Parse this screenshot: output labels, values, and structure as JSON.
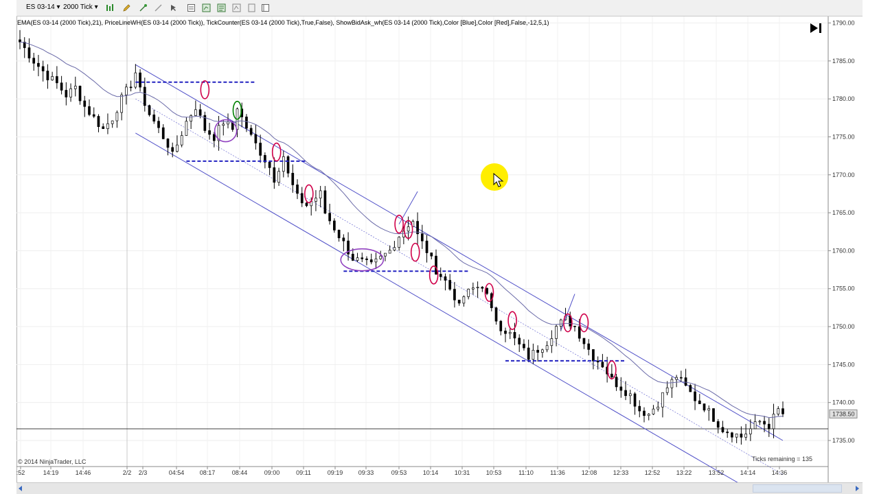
{
  "toolbar": {
    "instrument": "ES 03-14",
    "interval": "2000 Tick"
  },
  "indicator_label": "EMA(ES 03-14 (2000 Tick),21), PriceLineWH(ES 03-14 (2000 Tick)), TickCounter(ES 03-14 (2000 Tick),True,False), ShowBidAsk_wh(ES 03-14 (2000 Tick),Color [Blue],Color [Red],False,-12,5,1)",
  "copyright": "© 2014 NinjaTrader, LLC",
  "ticks_remaining": "Ticks remaining = 135",
  "colors": {
    "candle": "#000000",
    "ema": "#6a6aa8",
    "channel": "#5050c8",
    "dashed_level": "#2020c0",
    "red_marker": "#d0004a",
    "purple_marker": "#9040c0",
    "green_marker": "#008000",
    "cursor_highlight": "#ffee00"
  },
  "chart_data": {
    "type": "candlestick",
    "instrument": "ES 03-14",
    "interval": "2000 Tick",
    "y_ticks": [
      1790,
      1785,
      1780,
      1775,
      1770,
      1765,
      1760,
      1755,
      1750,
      1745,
      1740,
      1735
    ],
    "y_tick_labels": [
      "1790.00",
      "1785.00",
      "1780.00",
      "1775.00",
      "1770.00",
      "1765.00",
      "1760.00",
      "1755.00",
      "1750.00",
      "1745.00",
      "1740.00",
      "1735.00"
    ],
    "ylim": [
      1732.5,
      1790.3
    ],
    "current_price": "1738.50",
    "x_tick_labels": [
      ":52",
      "14:19",
      "14:46",
      "2/2",
      "2/3",
      "04:54",
      "08:17",
      "08:44",
      "09:00",
      "09:11",
      "09:19",
      "09:33",
      "09:53",
      "10:14",
      "10:31",
      "10:53",
      "11:10",
      "11:36",
      "12:08",
      "12:33",
      "12:52",
      "13:22",
      "13:52",
      "14:14",
      "14:36"
    ],
    "price_path": [
      [
        0,
        1787.5
      ],
      [
        3,
        1785
      ],
      [
        6,
        1783
      ],
      [
        8,
        1782
      ],
      [
        10,
        1780.5
      ],
      [
        12,
        1781.5
      ],
      [
        14,
        1779
      ],
      [
        16,
        1777.5
      ],
      [
        18,
        1776
      ],
      [
        20,
        1777.5
      ],
      [
        22,
        1780
      ],
      [
        24,
        1782
      ],
      [
        25,
        1783.5
      ],
      [
        26,
        1781
      ],
      [
        28,
        1778
      ],
      [
        30,
        1776
      ],
      [
        32,
        1774
      ],
      [
        33,
        1772.5
      ],
      [
        34,
        1774
      ],
      [
        36,
        1777
      ],
      [
        38,
        1779
      ],
      [
        40,
        1776
      ],
      [
        42,
        1775
      ],
      [
        44,
        1777
      ],
      [
        46,
        1776
      ],
      [
        47,
        1779
      ],
      [
        48,
        1777.5
      ],
      [
        50,
        1775
      ],
      [
        52,
        1773
      ],
      [
        54,
        1771
      ],
      [
        55,
        1769.5
      ],
      [
        56,
        1771
      ],
      [
        57,
        1772.5
      ],
      [
        58,
        1770
      ],
      [
        60,
        1767
      ],
      [
        62,
        1766
      ],
      [
        64,
        1767
      ],
      [
        65,
        1767.5
      ],
      [
        66,
        1765
      ],
      [
        68,
        1763
      ],
      [
        70,
        1761
      ],
      [
        72,
        1759
      ],
      [
        74,
        1758.5
      ],
      [
        76,
        1758
      ],
      [
        78,
        1759
      ],
      [
        80,
        1760
      ],
      [
        82,
        1762
      ],
      [
        84,
        1763.5
      ],
      [
        85,
        1764
      ],
      [
        86,
        1762
      ],
      [
        88,
        1760
      ],
      [
        90,
        1757.5
      ],
      [
        92,
        1756
      ],
      [
        94,
        1754
      ],
      [
        95,
        1752.5
      ],
      [
        96,
        1754
      ],
      [
        98,
        1755
      ],
      [
        100,
        1755.5
      ],
      [
        101,
        1754
      ],
      [
        102,
        1752
      ],
      [
        104,
        1750
      ],
      [
        106,
        1749
      ],
      [
        108,
        1747.5
      ],
      [
        110,
        1746
      ],
      [
        112,
        1747
      ],
      [
        114,
        1748
      ],
      [
        116,
        1750
      ],
      [
        118,
        1751
      ],
      [
        120,
        1750
      ],
      [
        122,
        1748
      ],
      [
        124,
        1746
      ],
      [
        126,
        1745
      ],
      [
        128,
        1743
      ],
      [
        130,
        1742
      ],
      [
        132,
        1741
      ],
      [
        134,
        1739
      ],
      [
        136,
        1738.5
      ],
      [
        138,
        1740
      ],
      [
        140,
        1742
      ],
      [
        142,
        1743.5
      ],
      [
        144,
        1742
      ],
      [
        146,
        1740.5
      ],
      [
        148,
        1739.5
      ],
      [
        150,
        1738
      ],
      [
        152,
        1736.5
      ],
      [
        154,
        1736
      ],
      [
        156,
        1735.5
      ],
      [
        158,
        1736.5
      ],
      [
        160,
        1737.5
      ],
      [
        162,
        1737
      ],
      [
        164,
        1739
      ],
      [
        165,
        1738.5
      ]
    ],
    "bar_count": 166,
    "channel": {
      "upper": [
        [
          25,
          1784.5
        ],
        [
          165,
          1735
        ]
      ],
      "middle": [
        [
          25,
          1780
        ],
        [
          165,
          1730.5
        ]
      ],
      "lower": [
        [
          25,
          1775.5
        ],
        [
          165,
          1726
        ]
      ]
    },
    "levels": [
      {
        "price": 1782.2,
        "from_bar": 25,
        "to_bar": 51
      },
      {
        "price": 1771.8,
        "from_bar": 36,
        "to_bar": 62
      },
      {
        "price": 1757.3,
        "from_bar": 70,
        "to_bar": 97
      },
      {
        "price": 1745.5,
        "from_bar": 105,
        "to_bar": 131
      }
    ],
    "markers": [
      {
        "bar": 40,
        "price": 1781.2,
        "kind": "red"
      },
      {
        "bar": 47,
        "price": 1778.5,
        "kind": "green"
      },
      {
        "bar": 44.5,
        "price": 1775.8,
        "kind": "purple-wide"
      },
      {
        "bar": 55.5,
        "price": 1773.0,
        "kind": "red"
      },
      {
        "bar": 62.5,
        "price": 1767.5,
        "kind": "red"
      },
      {
        "bar": 74,
        "price": 1758.8,
        "kind": "purple-wide-large"
      },
      {
        "bar": 82,
        "price": 1763.5,
        "kind": "red"
      },
      {
        "bar": 84,
        "price": 1762.8,
        "kind": "red"
      },
      {
        "bar": 85.5,
        "price": 1759.8,
        "kind": "red"
      },
      {
        "bar": 89.5,
        "price": 1756.8,
        "kind": "red"
      },
      {
        "bar": 101.5,
        "price": 1754.5,
        "kind": "red"
      },
      {
        "bar": 106.5,
        "price": 1750.8,
        "kind": "red"
      },
      {
        "bar": 118.5,
        "price": 1750.5,
        "kind": "red"
      },
      {
        "bar": 122,
        "price": 1750.5,
        "kind": "red"
      },
      {
        "bar": 128,
        "price": 1744.3,
        "kind": "red"
      }
    ],
    "spikes": [
      {
        "from": [
          82,
          1763.5
        ],
        "to": [
          86,
          1767.8
        ]
      },
      {
        "from": [
          117,
          1749.5
        ],
        "to": [
          120,
          1754.3
        ]
      }
    ]
  }
}
